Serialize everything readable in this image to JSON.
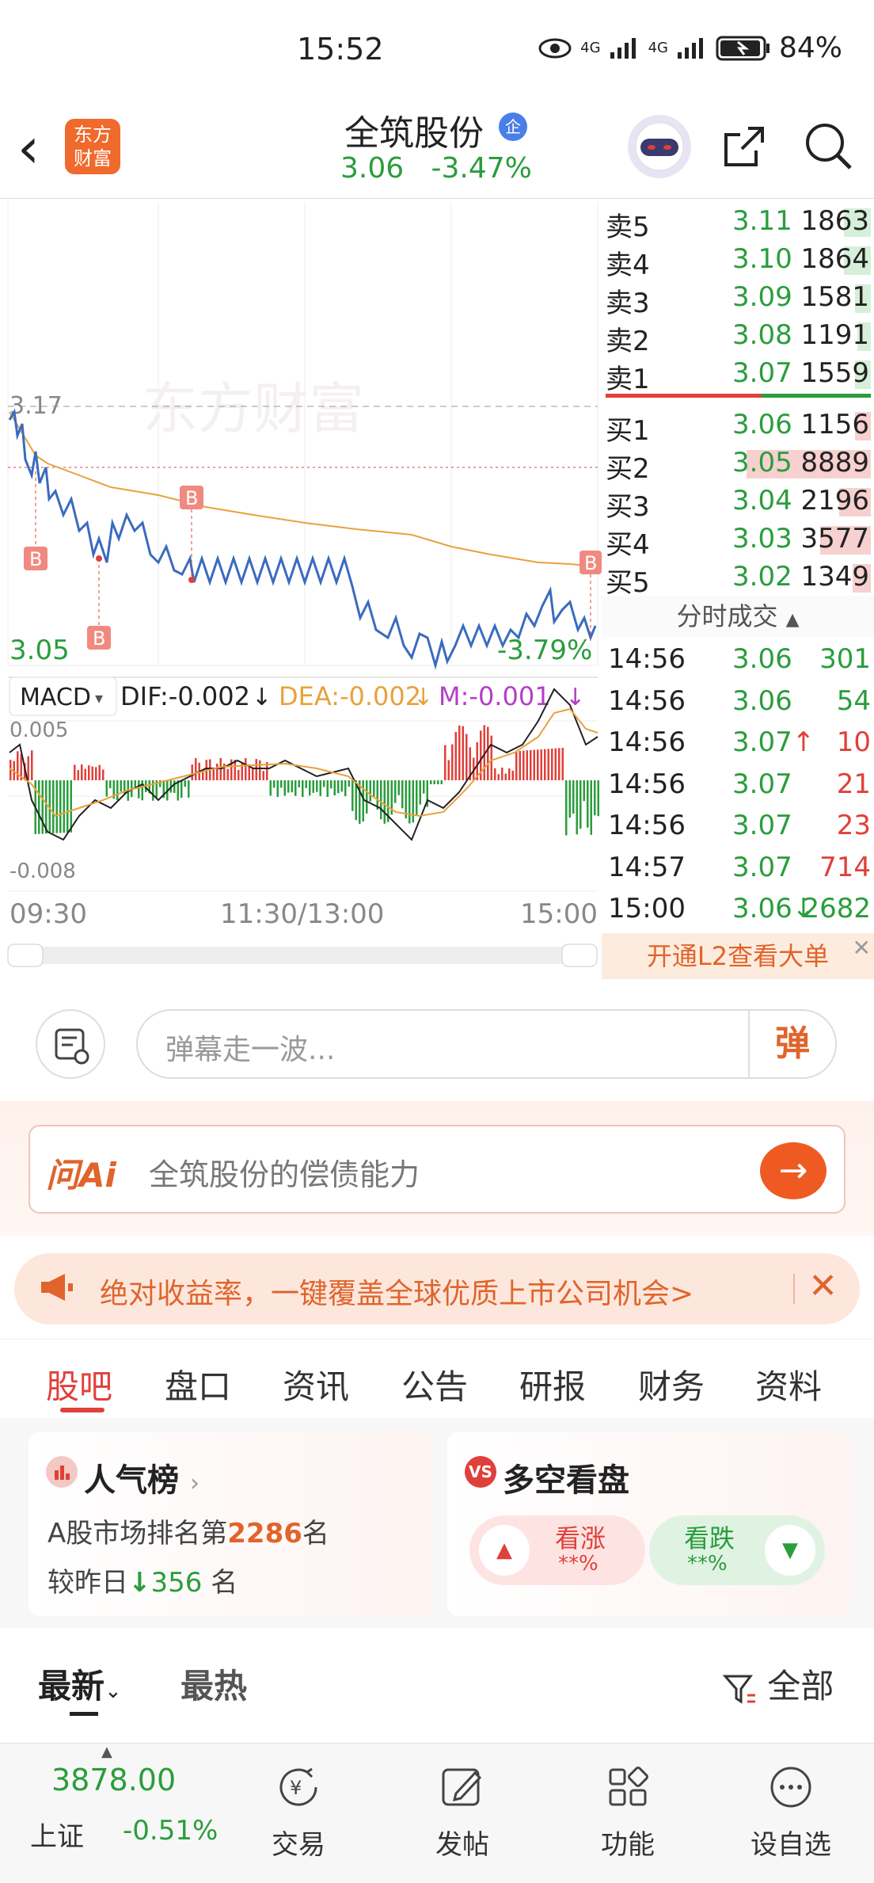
{
  "status_bar": {
    "time": "15:52",
    "battery": "84%",
    "signal1": "4G",
    "signal2": "4G"
  },
  "header": {
    "logo_text": "东方\n财富",
    "stock_name": "全筑股份",
    "company_badge": "企",
    "price": "3.06",
    "change_pct": "-3.47%"
  },
  "chart": {
    "watermark": "东方财富",
    "prev_close_label": "3.17",
    "low_label": "3.05",
    "low_pct_label": "-3.79%",
    "marker_b": "B",
    "macd": {
      "selector": "MACD",
      "dif": "DIF:-0.002",
      "dea": "DEA:-0.002",
      "m": "M:-0.001",
      "top_label": "0.005",
      "bottom_label": "-0.008"
    },
    "time_axis": [
      "09:30",
      "11:30/13:00",
      "15:00"
    ],
    "colors": {
      "price_line": "#3a6bbf",
      "avg_line": "#e8a23c",
      "up": "#e0403a",
      "down": "#2a9d3c"
    }
  },
  "order_book": {
    "asks": [
      {
        "label": "卖5",
        "price": "3.11",
        "vol": "1863",
        "bar": 0.1
      },
      {
        "label": "卖4",
        "price": "3.10",
        "vol": "1864",
        "bar": 0.1
      },
      {
        "label": "卖3",
        "price": "3.09",
        "vol": "1581",
        "bar": 0.06
      },
      {
        "label": "卖2",
        "price": "3.08",
        "vol": "1191",
        "bar": 0.05
      },
      {
        "label": "卖1",
        "price": "3.07",
        "vol": "1559",
        "bar": 0.06
      }
    ],
    "bids": [
      {
        "label": "买1",
        "price": "3.06",
        "vol": "1156",
        "bar": 0.06
      },
      {
        "label": "买2",
        "price": "3.05",
        "vol": "8889",
        "bar": 0.47
      },
      {
        "label": "买3",
        "price": "3.04",
        "vol": "2196",
        "bar": 0.12
      },
      {
        "label": "买4",
        "price": "3.03",
        "vol": "3577",
        "bar": 0.19
      },
      {
        "label": "买5",
        "price": "3.02",
        "vol": "1349",
        "bar": 0.07
      }
    ],
    "trades_header": "分时成交",
    "trades": [
      {
        "time": "14:56",
        "price": "3.06",
        "vol": "301",
        "dir": ""
      },
      {
        "time": "14:56",
        "price": "3.06",
        "vol": "54",
        "dir": ""
      },
      {
        "time": "14:56",
        "price": "3.07",
        "vol": "10",
        "dir": "↑"
      },
      {
        "time": "14:56",
        "price": "3.07",
        "vol": "21",
        "dir": ""
      },
      {
        "time": "14:56",
        "price": "3.07",
        "vol": "23",
        "dir": ""
      },
      {
        "time": "14:57",
        "price": "3.07",
        "vol": "714",
        "dir": ""
      },
      {
        "time": "15:00",
        "price": "3.06",
        "vol": "2682",
        "dir": "↓"
      }
    ],
    "l2_promo": "开通L2查看大单"
  },
  "comment": {
    "placeholder": "弹幕走一波...",
    "danmu_btn": "弹"
  },
  "ai": {
    "logo": "问Ai",
    "query": "全筑股份的偿债能力"
  },
  "banner": {
    "text": "绝对收益率，一键覆盖全球优质上市公司机会>"
  },
  "tabs": [
    "股吧",
    "盘口",
    "资讯",
    "公告",
    "研报",
    "财务",
    "资料"
  ],
  "popularity": {
    "title": "人气榜",
    "rank_prefix": "A股市场排名第",
    "rank": "2286",
    "rank_suffix": "名",
    "change_prefix": "较昨日",
    "change": "356",
    "change_suffix": "名"
  },
  "sentiment": {
    "title": "多空看盘",
    "bull_label": "看涨",
    "bull_val": "**%",
    "bear_label": "看跌",
    "bear_val": "**%"
  },
  "feed_tabs": {
    "latest": "最新",
    "hot": "最热",
    "filter": "全部"
  },
  "bottom_nav": {
    "index_value": "3878.00",
    "index_name": "上证",
    "index_change": "-0.51%",
    "items": [
      "交易",
      "发帖",
      "功能",
      "设自选"
    ]
  }
}
